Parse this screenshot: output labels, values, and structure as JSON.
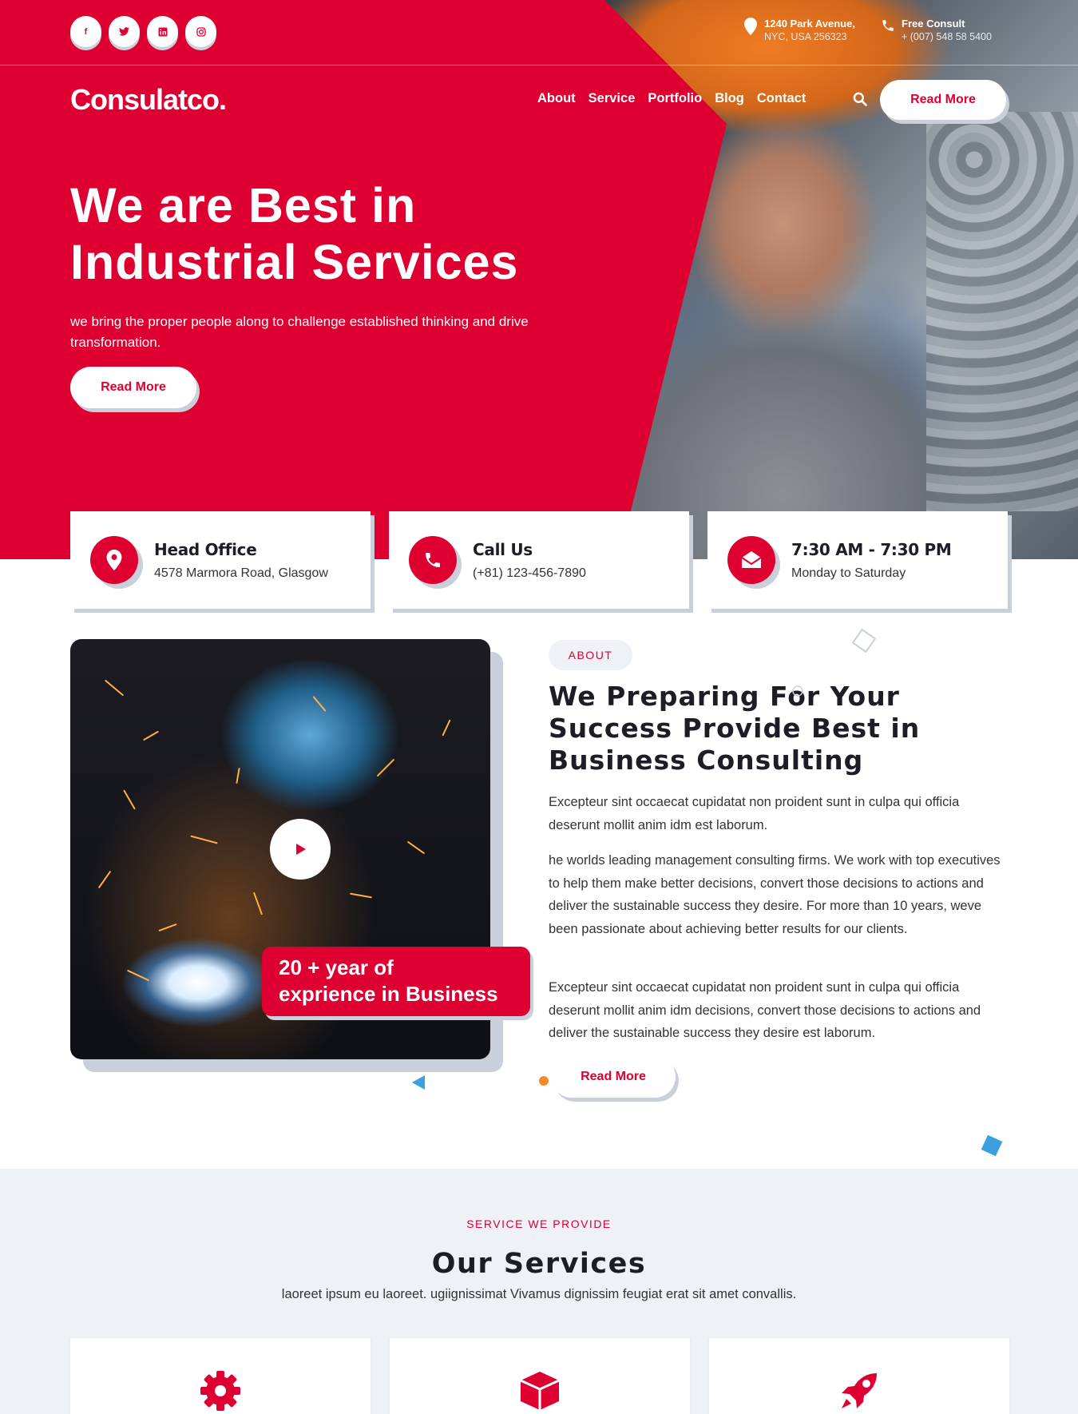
{
  "brand": {
    "logo": "Consulatco.",
    "accent_color": "#dd0031"
  },
  "topbar": {
    "socials": [
      {
        "icon": "facebook-icon",
        "glyph": "f"
      },
      {
        "icon": "twitter-icon",
        "glyph": "t"
      },
      {
        "icon": "linkedin-icon",
        "glyph": "in"
      },
      {
        "icon": "instagram-icon",
        "glyph": "ig"
      }
    ],
    "address": {
      "icon": "map-pin-icon",
      "title": "1240 Park Avenue,",
      "sub": "NYC, USA 256323"
    },
    "phone": {
      "icon": "phone-icon",
      "title": "Free Consult",
      "sub": "+ (007) 548 58 5400"
    }
  },
  "nav": {
    "items": [
      "About",
      "Service",
      "Portfolio",
      "Blog",
      "Contact"
    ],
    "search_icon": "search-icon",
    "cta": "Read More"
  },
  "hero": {
    "title_line1": "We are Best in",
    "title_line2": "Industrial Services",
    "text": "we bring the proper people along to challenge established thinking and drive transformation.",
    "cta": "Read More"
  },
  "info_cards": [
    {
      "icon": "map-pin-icon",
      "title": "Head Office",
      "text": "4578 Marmora Road, Glasgow"
    },
    {
      "icon": "phone-icon",
      "title": "Call Us",
      "text": "(+81) 123-456-7890"
    },
    {
      "icon": "envelope-open-icon",
      "title": "7:30 AM - 7:30 PM",
      "text": "Monday to Saturday"
    }
  ],
  "about": {
    "video_icon": "play-icon",
    "experience_line1": "20 + year of",
    "experience_line2": "exprience in Business",
    "tag": "ABOUT",
    "title": "We Preparing For Your Success Provide Best in Business Consulting",
    "p1": "Excepteur sint occaecat cupidatat non proident sunt in culpa qui officia deserunt mollit anim idm est laborum.",
    "p2": "he worlds leading management consulting firms. We work with top executives to help them make better decisions, convert those decisions to actions and deliver the sustainable success they desire. For more than 10 years, weve been passionate about achieving better results for our clients.",
    "p3": "Excepteur sint occaecat cupidatat non proident sunt in culpa qui officia deserunt mollit anim idm decisions, convert those decisions to actions and deliver the sustainable success they desire est laborum.",
    "cta": "Read More"
  },
  "services": {
    "tag": "SERVICE WE PROVIDE",
    "title": "Our Services",
    "subtitle": "laoreet ipsum eu laoreet. ugiignissimat Vivamus dignissim feugiat erat sit amet convallis.",
    "cards": [
      {
        "icon": "gear-icon"
      },
      {
        "icon": "box-icon"
      },
      {
        "icon": "rocket-icon"
      }
    ]
  }
}
